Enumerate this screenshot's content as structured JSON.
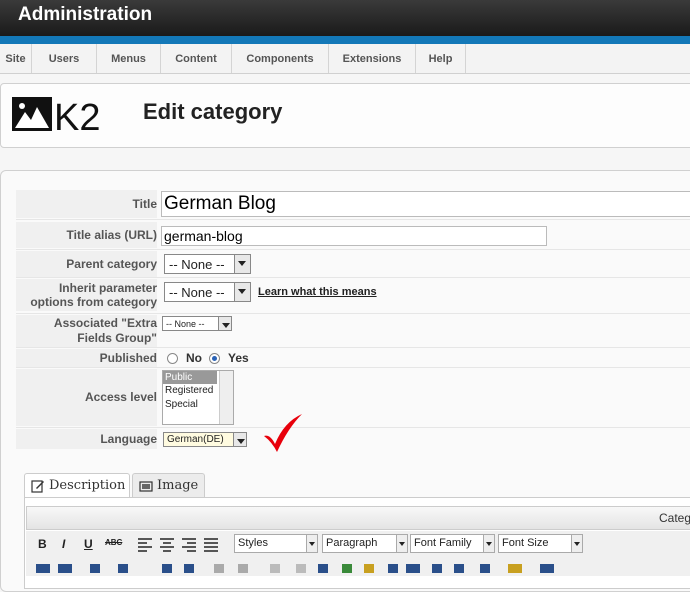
{
  "header": {
    "title": "Administration"
  },
  "menu": [
    "Site",
    "Users",
    "Menus",
    "Content",
    "Components",
    "Extensions",
    "Help"
  ],
  "page": {
    "logo_text": "K2",
    "title": "Edit category"
  },
  "form": {
    "title_label": "Title",
    "title_value": "German Blog",
    "alias_label": "Title alias (URL)",
    "alias_value": "german-blog",
    "parent_label": "Parent category",
    "parent_value": "-- None --",
    "inherit_label": "Inherit parameter options from category",
    "inherit_value": "-- None --",
    "inherit_link": "Learn what this means",
    "extra_label": "Associated \"Extra Fields Group\"",
    "extra_value": "-- None --",
    "published_label": "Published",
    "published_no": "No",
    "published_yes": "Yes",
    "access_label": "Access level",
    "access_options": [
      "Public",
      "Registered",
      "Special"
    ],
    "language_label": "Language",
    "language_value": "German(DE)"
  },
  "tabs": [
    "Description",
    "Image"
  ],
  "editor": {
    "corner_text": "Categ",
    "styles": "Styles",
    "paragraph": "Paragraph",
    "font_family": "Font Family",
    "font_size": "Font Size"
  },
  "colors": {
    "accent": "#1378b8",
    "checkmark": "#e8000b"
  }
}
